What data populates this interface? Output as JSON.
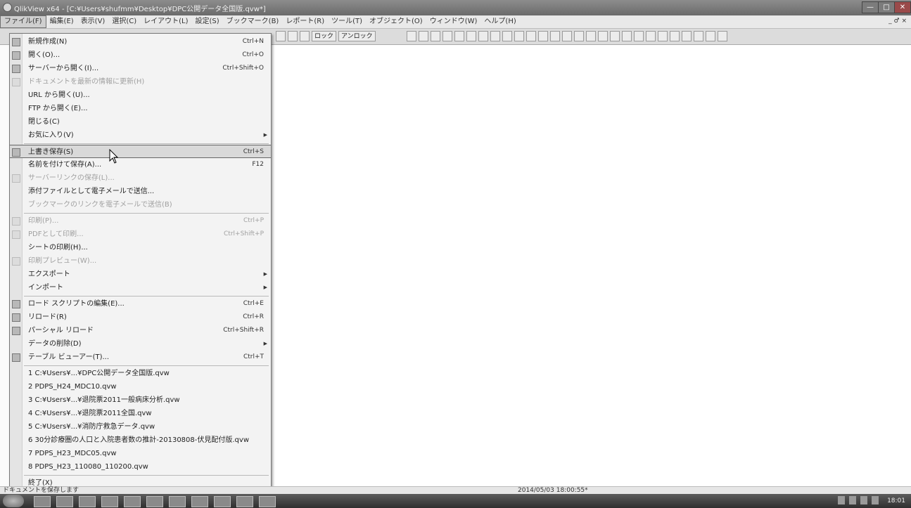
{
  "window": {
    "title": "QlikView x64 - [C:¥Users¥shufmm¥Desktop¥DPC公開データ全国版.qvw*]",
    "controls": {
      "minimize": "—",
      "maximize": "□",
      "close": "✕"
    }
  },
  "menubar": {
    "items": [
      "ファイル(F)",
      "編集(E)",
      "表示(V)",
      "選択(C)",
      "レイアウト(L)",
      "設定(S)",
      "ブックマーク(B)",
      "レポート(R)",
      "ツール(T)",
      "オブジェクト(O)",
      "ウィンドウ(W)",
      "ヘルプ(H)"
    ],
    "mdi_controls": "_ ♂ ×"
  },
  "toolbar": {
    "lock_label": "ロック",
    "unlock_label": "アンロック"
  },
  "file_menu": {
    "items": [
      {
        "label": "新規作成(N)",
        "shortcut": "Ctrl+N"
      },
      {
        "label": "開く(O)...",
        "shortcut": "Ctrl+O"
      },
      {
        "label": "サーバーから開く(I)...",
        "shortcut": "Ctrl+Shift+O"
      },
      {
        "label": "ドキュメントを最新の情報に更新(H)",
        "shortcut": ""
      },
      {
        "label": "URL から開く(U)...",
        "shortcut": ""
      },
      {
        "label": "FTP から開く(E)...",
        "shortcut": ""
      },
      {
        "label": "閉じる(C)",
        "shortcut": ""
      },
      {
        "label": "お気に入り(V)",
        "shortcut": ""
      },
      {
        "label": "上書き保存(S)",
        "shortcut": "Ctrl+S"
      },
      {
        "label": "名前を付けて保存(A)...",
        "shortcut": "F12"
      },
      {
        "label": "サーバーリンクの保存(L)...",
        "shortcut": ""
      },
      {
        "label": "添付ファイルとして電子メールで送信...",
        "shortcut": ""
      },
      {
        "label": "ブックマークのリンクを電子メールで送信(B)",
        "shortcut": ""
      },
      {
        "label": "印刷(P)...",
        "shortcut": "Ctrl+P"
      },
      {
        "label": "PDFとして印刷...",
        "shortcut": "Ctrl+Shift+P"
      },
      {
        "label": "シートの印刷(H)...",
        "shortcut": ""
      },
      {
        "label": "印刷プレビュー(W)...",
        "shortcut": ""
      },
      {
        "label": "エクスポート",
        "shortcut": ""
      },
      {
        "label": "インポート",
        "shortcut": ""
      },
      {
        "label": "ロード スクリプトの編集(E)...",
        "shortcut": "Ctrl+E"
      },
      {
        "label": "リロード(R)",
        "shortcut": "Ctrl+R"
      },
      {
        "label": "パーシャル リロード",
        "shortcut": "Ctrl+Shift+R"
      },
      {
        "label": "データの削除(D)",
        "shortcut": ""
      },
      {
        "label": "テーブル ビューアー(T)...",
        "shortcut": "Ctrl+T"
      },
      {
        "label": "1 C:¥Users¥...¥DPC公開データ全国版.qvw",
        "shortcut": ""
      },
      {
        "label": "2 PDPS_H24_MDC10.qvw",
        "shortcut": ""
      },
      {
        "label": "3 C:¥Users¥...¥退院票2011一般病床分析.qvw",
        "shortcut": ""
      },
      {
        "label": "4 C:¥Users¥...¥退院票2011全国.qvw",
        "shortcut": ""
      },
      {
        "label": "5 C:¥Users¥...¥消防庁救急データ.qvw",
        "shortcut": ""
      },
      {
        "label": "6 30分診療圏の人口と入院患者数の推計-20130808-伏見配付版.qvw",
        "shortcut": ""
      },
      {
        "label": "7 PDPS_H23_MDC05.qvw",
        "shortcut": ""
      },
      {
        "label": "8 PDPS_H23_110080_110200.qvw",
        "shortcut": ""
      },
      {
        "label": "終了(X)",
        "shortcut": ""
      }
    ]
  },
  "statusbar": {
    "hint": "ドキュメントを保存します",
    "datetime": "2014/05/03 18:00:55*"
  },
  "taskbar": {
    "clock": "18:01"
  },
  "colors": {
    "highlight": "#d9d9d9",
    "disabled_text": "#a0a0a0"
  }
}
